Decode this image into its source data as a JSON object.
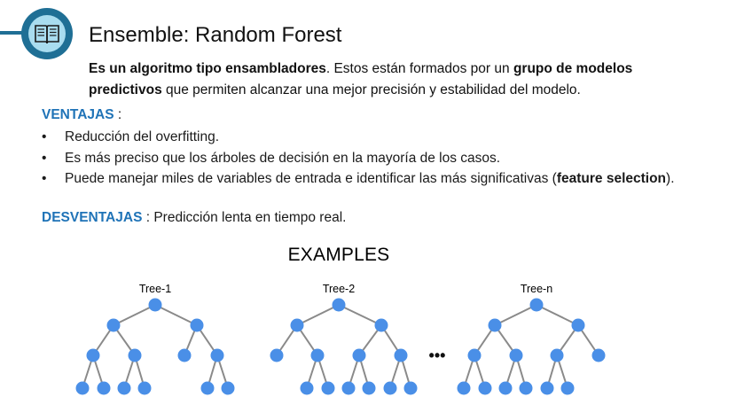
{
  "header": {
    "title": "Ensemble: Random Forest",
    "icon": "book-icon"
  },
  "intro": {
    "b1": "Es un algoritmo tipo ensambladores",
    "t1": ". Estos están formados por un ",
    "b2": "grupo de modelos predictivos",
    "t2": " que permiten alcanzar una mejor precisión y estabilidad del modelo."
  },
  "ventajas": {
    "label": "VENTAJAS",
    "suffix": " :",
    "items": [
      "Reducción del overfitting.",
      "Es más preciso que los árboles de decisión en la mayoría de los casos."
    ],
    "item3_text": "Puede manejar miles de variables de entrada e identificar las más significativas (",
    "item3_bold": "feature selection",
    "item3_end": ").",
    "bullet": "•"
  },
  "desventajas": {
    "label": "DESVENTAJAS",
    "text": " : Predicción lenta en tiempo real."
  },
  "examples": {
    "title": "EXAMPLES",
    "ellipsis": "•••",
    "trees": [
      "Tree-1",
      "Tree-2",
      "Tree-n"
    ]
  },
  "colors": {
    "accent": "#1f73b7",
    "badge_dark": "#1f6f95",
    "badge_light": "#a9dcef",
    "node": "#4a8fe7",
    "edge": "#8a8a8a"
  }
}
